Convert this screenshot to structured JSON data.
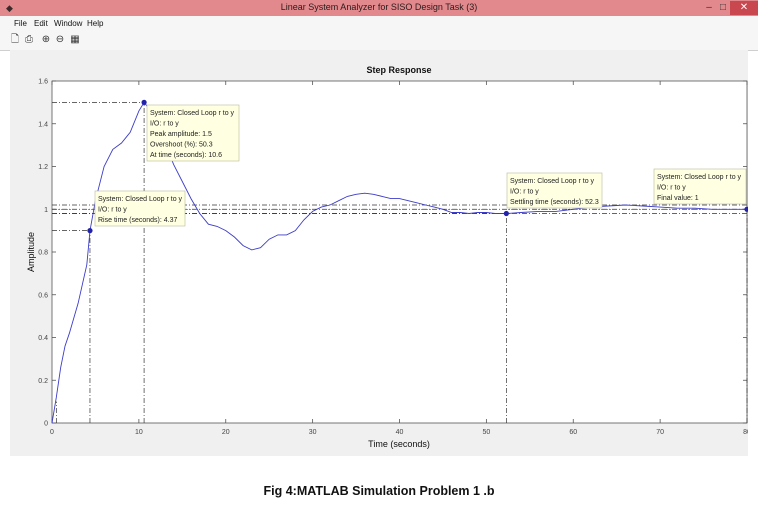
{
  "window": {
    "title": "Linear System Analyzer for SISO Design Task (3)",
    "minimize": "–",
    "maximize": "□",
    "close": "✕"
  },
  "menu": [
    "File",
    "Edit",
    "Window",
    "Help"
  ],
  "toolbar": [
    "new-file-icon",
    "print-icon",
    "zoom-in-icon",
    "zoom-out-icon",
    "grid-icon"
  ],
  "chart_data": {
    "type": "line",
    "title": "Step Response",
    "xlabel": "Time (seconds)",
    "ylabel": "Amplitude",
    "xlim": [
      0,
      80
    ],
    "ylim": [
      0,
      1.6
    ],
    "xticks": [
      "0",
      "10",
      "20",
      "30",
      "40",
      "50",
      "60",
      "70",
      "80"
    ],
    "yticks": [
      "0",
      "0.2",
      "0.4",
      "0.6",
      "0.8",
      "1",
      "1.2",
      "1.4",
      "1.6"
    ],
    "series": [
      {
        "color": "#3c3cc8",
        "x": [
          0,
          0.5,
          1,
          1.5,
          2,
          3,
          4,
          4.37,
          5,
          6,
          7,
          8,
          9,
          10,
          10.6,
          11,
          12,
          13,
          14,
          15,
          16,
          17,
          18,
          19,
          20,
          21,
          22,
          23,
          24,
          25,
          26,
          27,
          28,
          29,
          30,
          31,
          32,
          33,
          34,
          35,
          36,
          37,
          38,
          39,
          40,
          41,
          42,
          43,
          44,
          45,
          46,
          47,
          48,
          49,
          50,
          51,
          52.3,
          54,
          56,
          58,
          60,
          62,
          64,
          66,
          68,
          70,
          72,
          74,
          76,
          78,
          80
        ],
        "y": [
          0,
          0.12,
          0.26,
          0.36,
          0.42,
          0.56,
          0.74,
          0.9,
          1.04,
          1.2,
          1.28,
          1.31,
          1.36,
          1.46,
          1.5,
          1.48,
          1.4,
          1.31,
          1.21,
          1.13,
          1.05,
          0.98,
          0.93,
          0.92,
          0.9,
          0.87,
          0.83,
          0.81,
          0.82,
          0.86,
          0.88,
          0.88,
          0.9,
          0.95,
          0.99,
          1.01,
          1.02,
          1.04,
          1.06,
          1.07,
          1.075,
          1.07,
          1.06,
          1.05,
          1.05,
          1.04,
          1.03,
          1.02,
          1.01,
          1.0,
          0.985,
          0.985,
          0.98,
          0.985,
          0.985,
          0.98,
          0.98,
          0.985,
          0.99,
          0.99,
          1.0,
          1.01,
          1.015,
          1.02,
          1.015,
          1.01,
          1.005,
          1.005,
          1.0,
          1.0,
          1.0
        ]
      }
    ],
    "reference_lines": {
      "y": [
        1.02,
        0.98
      ],
      "final_value_line": 1.0
    },
    "markers": [
      {
        "label": "Rise time",
        "x": 4.37,
        "y": 0.9
      },
      {
        "label": "Peak",
        "x": 10.6,
        "y": 1.5
      },
      {
        "label": "Settling time",
        "x": 52.3,
        "y": 0.98
      },
      {
        "label": "Final value",
        "x": 80,
        "y": 1.0
      }
    ]
  },
  "datatips": [
    {
      "lines": [
        "System: Closed Loop r to y",
        "I/O: r to y",
        "Peak amplitude: 1.5",
        "Overshoot (%): 50.3",
        "At time (seconds): 10.6"
      ]
    },
    {
      "lines": [
        "System: Closed Loop r to y",
        "I/O: r to y",
        "Rise time (seconds): 4.37"
      ]
    },
    {
      "lines": [
        "System: Closed Loop r to y",
        "I/O: r to y",
        "Settling time (seconds): 52.3"
      ]
    },
    {
      "lines": [
        "System: Closed Loop r to y",
        "I/O: r to y",
        "Final value: 1"
      ]
    }
  ],
  "caption": "Fig 4:MATLAB Simulation Problem 1 .b"
}
